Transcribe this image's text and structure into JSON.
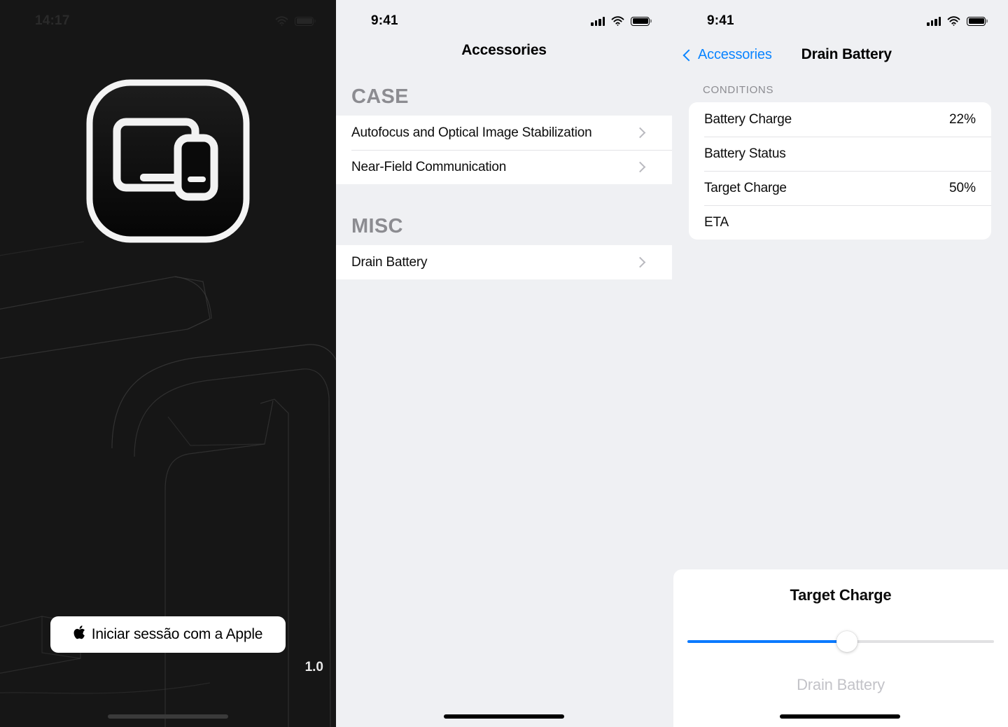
{
  "colors": {
    "accent_blue": "#0a7aff",
    "panel_dark_bg": "#161616",
    "panel_light_bg": "#eff0f3",
    "row_bg": "#ffffff",
    "section_header_gray": "#8c8c91",
    "disabled_gray": "#c3c3c8"
  },
  "panel_signin": {
    "status": {
      "time": "14:17",
      "wifi_icon": "wifi-icon",
      "battery_icon": "battery-icon"
    },
    "app_icon_name": "accessories-app-icon",
    "signin_button": {
      "label": "Iniciar sessão com a Apple",
      "glyph": "",
      "icon_name": "apple-logo-icon"
    },
    "version": "1.0"
  },
  "panel_accessories": {
    "status": {
      "time": "9:41",
      "signal_icon": "cellular-signal-icon",
      "wifi_icon": "wifi-icon",
      "battery_icon": "battery-icon"
    },
    "nav_title": "Accessories",
    "sections": [
      {
        "header": "CASE",
        "rows": [
          {
            "label": "Autofocus and Optical Image Stabilization",
            "accessory": "chevron-right-icon"
          },
          {
            "label": "Near-Field Communication",
            "accessory": "chevron-right-icon"
          }
        ]
      },
      {
        "header": "MISC",
        "rows": [
          {
            "label": "Drain Battery",
            "accessory": "chevron-right-icon"
          }
        ]
      }
    ]
  },
  "panel_drain_battery": {
    "status": {
      "time": "9:41",
      "signal_icon": "cellular-signal-icon",
      "wifi_icon": "wifi-icon",
      "battery_icon": "battery-icon"
    },
    "back_label": "Accessories",
    "nav_title": "Drain Battery",
    "section_header": "CONDITIONS",
    "conditions": [
      {
        "label": "Battery Charge",
        "value": "22%"
      },
      {
        "label": "Battery Status",
        "value": ""
      },
      {
        "label": "Target Charge",
        "value": "50%"
      },
      {
        "label": "ETA",
        "value": ""
      }
    ],
    "sheet": {
      "title": "Target Charge",
      "slider_percent": 52,
      "action_label": "Drain Battery"
    }
  }
}
